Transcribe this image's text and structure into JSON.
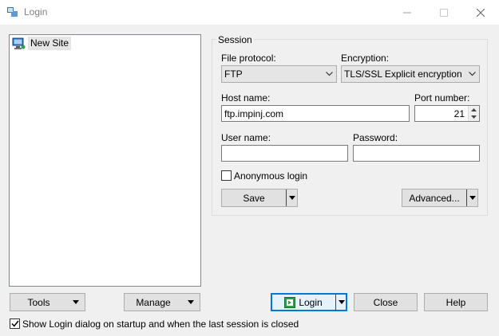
{
  "window": {
    "title": "Login",
    "controls": {
      "minimize": "minimize-icon",
      "maximize": "maximize-icon",
      "close": "close-icon"
    }
  },
  "site_tree": {
    "items": [
      {
        "label": "New Site",
        "icon": "computer-icon",
        "selected": true
      }
    ]
  },
  "session": {
    "legend": "Session",
    "file_protocol": {
      "label": "File protocol:",
      "value": "FTP"
    },
    "encryption": {
      "label": "Encryption:",
      "value": "TLS/SSL Explicit encryption"
    },
    "host_name": {
      "label": "Host name:",
      "value": "ftp.impinj.com"
    },
    "port_number": {
      "label": "Port number:",
      "value": "21"
    },
    "user_name": {
      "label": "User name:",
      "value": ""
    },
    "password": {
      "label": "Password:",
      "value": ""
    },
    "anonymous_login": {
      "label": "Anonymous login",
      "checked": false
    },
    "save_label": "Save",
    "advanced_label": "Advanced..."
  },
  "bottom": {
    "tools_label": "Tools",
    "manage_label": "Manage",
    "login_label": "Login",
    "close_label": "Close",
    "help_label": "Help",
    "show_login_dialog": {
      "label": "Show Login dialog on startup and when the last session is closed",
      "checked": true
    }
  },
  "colors": {
    "accent": "#0078d7",
    "login_icon": "#2ea043"
  }
}
